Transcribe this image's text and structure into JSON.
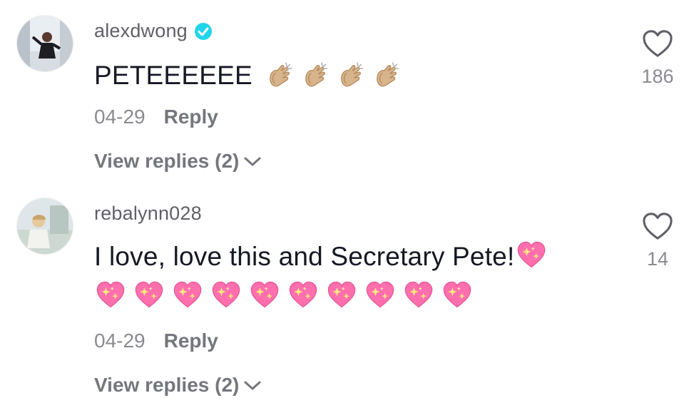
{
  "comments": [
    {
      "username": "alexdwong",
      "verified": true,
      "text": "PETEEEEEE",
      "emoji": [
        "clapping-hands",
        "clapping-hands",
        "clapping-hands",
        "clapping-hands"
      ],
      "date": "04-29",
      "reply_label": "Reply",
      "view_replies": "View replies (2)",
      "likes": "186"
    },
    {
      "username": "rebalynn028",
      "verified": false,
      "text": "I love, love this and Secretary Pete!",
      "emoji": [
        "sparkling-heart",
        "sparkling-heart",
        "sparkling-heart",
        "sparkling-heart",
        "sparkling-heart",
        "sparkling-heart",
        "sparkling-heart",
        "sparkling-heart",
        "sparkling-heart",
        "sparkling-heart",
        "sparkling-heart"
      ],
      "date": "04-29",
      "reply_label": "Reply",
      "view_replies": "View replies (2)",
      "likes": "14"
    }
  ],
  "colors": {
    "verified": "#20d5ec",
    "heart_emoji": "#ff6fae",
    "clap_skin": "#d7b48b"
  }
}
